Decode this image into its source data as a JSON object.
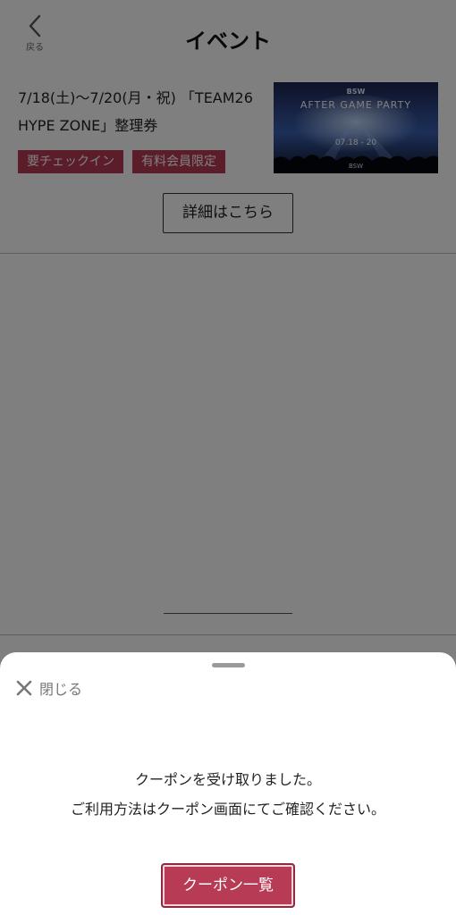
{
  "header": {
    "back_label": "戻る",
    "title": "イベント"
  },
  "event": {
    "title_line1": "7/18(土)〜7/20(月・祝) 「TEAM26",
    "title_line2": "HYPE ZONE」整理券",
    "tags": [
      "要チェックイン",
      "有料会員限定"
    ],
    "thumbnail": {
      "brand": "BSW",
      "heading": "AFTER GAME PARTY",
      "dates": "07.18 - 20",
      "footer": "BSW"
    },
    "detail_button": "詳細はこちら"
  },
  "sheet": {
    "close_label": "閉じる",
    "message_line1": "クーポンを受け取りました。",
    "message_line2": "ご利用方法はクーポン画面にてご確認ください。",
    "coupon_button": "クーポン一覧"
  },
  "colors": {
    "accent": "#b73b55",
    "overlay": "rgba(0,0,0,0.5)"
  }
}
